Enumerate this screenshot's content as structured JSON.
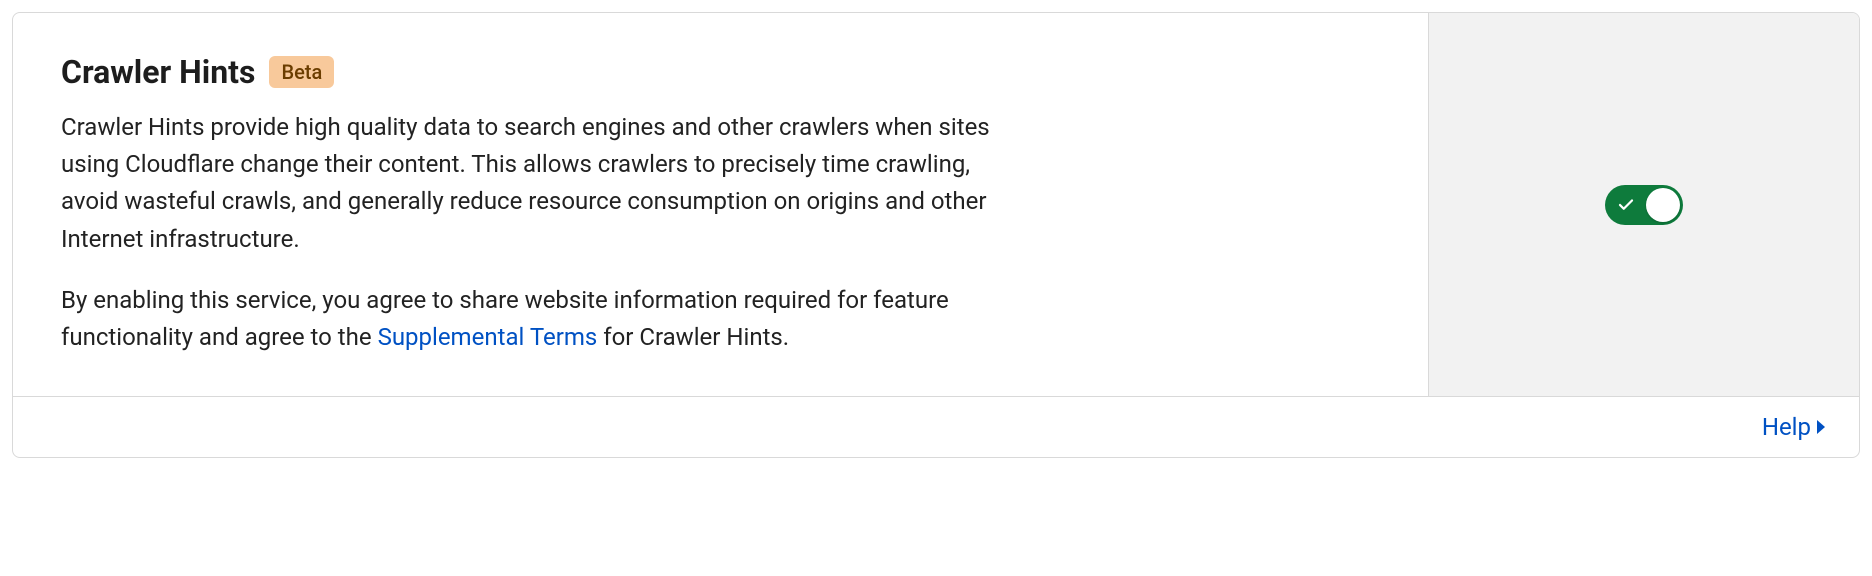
{
  "card": {
    "title": "Crawler Hints",
    "badge": "Beta",
    "description_part1": "Crawler Hints provide high quality data to search engines and other crawlers when sites using Cloudflare change their content. This allows crawlers to precisely time crawling, avoid wasteful crawls, and generally reduce resource consumption on origins and other Internet infrastructure.",
    "description_part2a": "By enabling this service, you agree to share website information required for feature functionality and agree to the ",
    "description_link": "Supplemental Terms",
    "description_part2b": " for Crawler Hints.",
    "toggle_enabled": true,
    "help_label": "Help"
  },
  "colors": {
    "toggle_on": "#0e7b3c",
    "link": "#0051c3",
    "badge_bg": "#f8c99b"
  }
}
